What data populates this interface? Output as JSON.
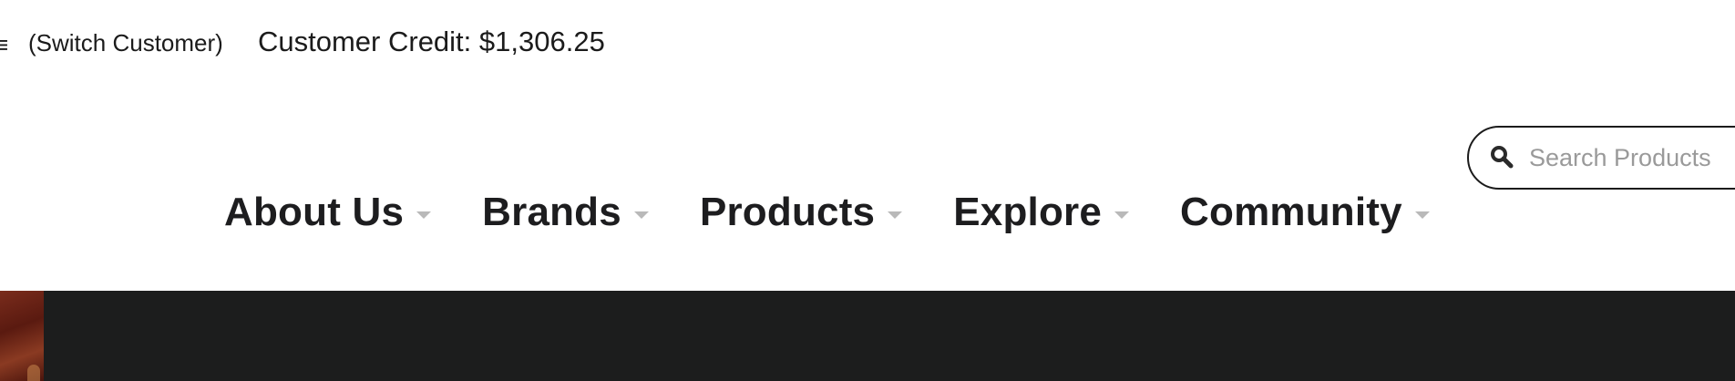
{
  "topbar": {
    "menu_icon": "menu-icon",
    "switch_customer": "(Switch Customer)",
    "credit_label": "Customer Credit: $1,306.25"
  },
  "search": {
    "placeholder": "Search Products",
    "value": "",
    "icon": "search-icon"
  },
  "nav": {
    "items": [
      {
        "label": "About Us",
        "icon": "chevron-down-icon"
      },
      {
        "label": "Brands",
        "icon": "chevron-down-icon"
      },
      {
        "label": "Products",
        "icon": "chevron-down-icon"
      },
      {
        "label": "Explore",
        "icon": "chevron-down-icon"
      },
      {
        "label": "Community",
        "icon": "chevron-down-icon"
      }
    ]
  },
  "colors": {
    "text": "#1d1d1f",
    "caret": "#b9b9b9",
    "banner_bg": "#1c1d1d",
    "placeholder": "#9a9a9a"
  }
}
